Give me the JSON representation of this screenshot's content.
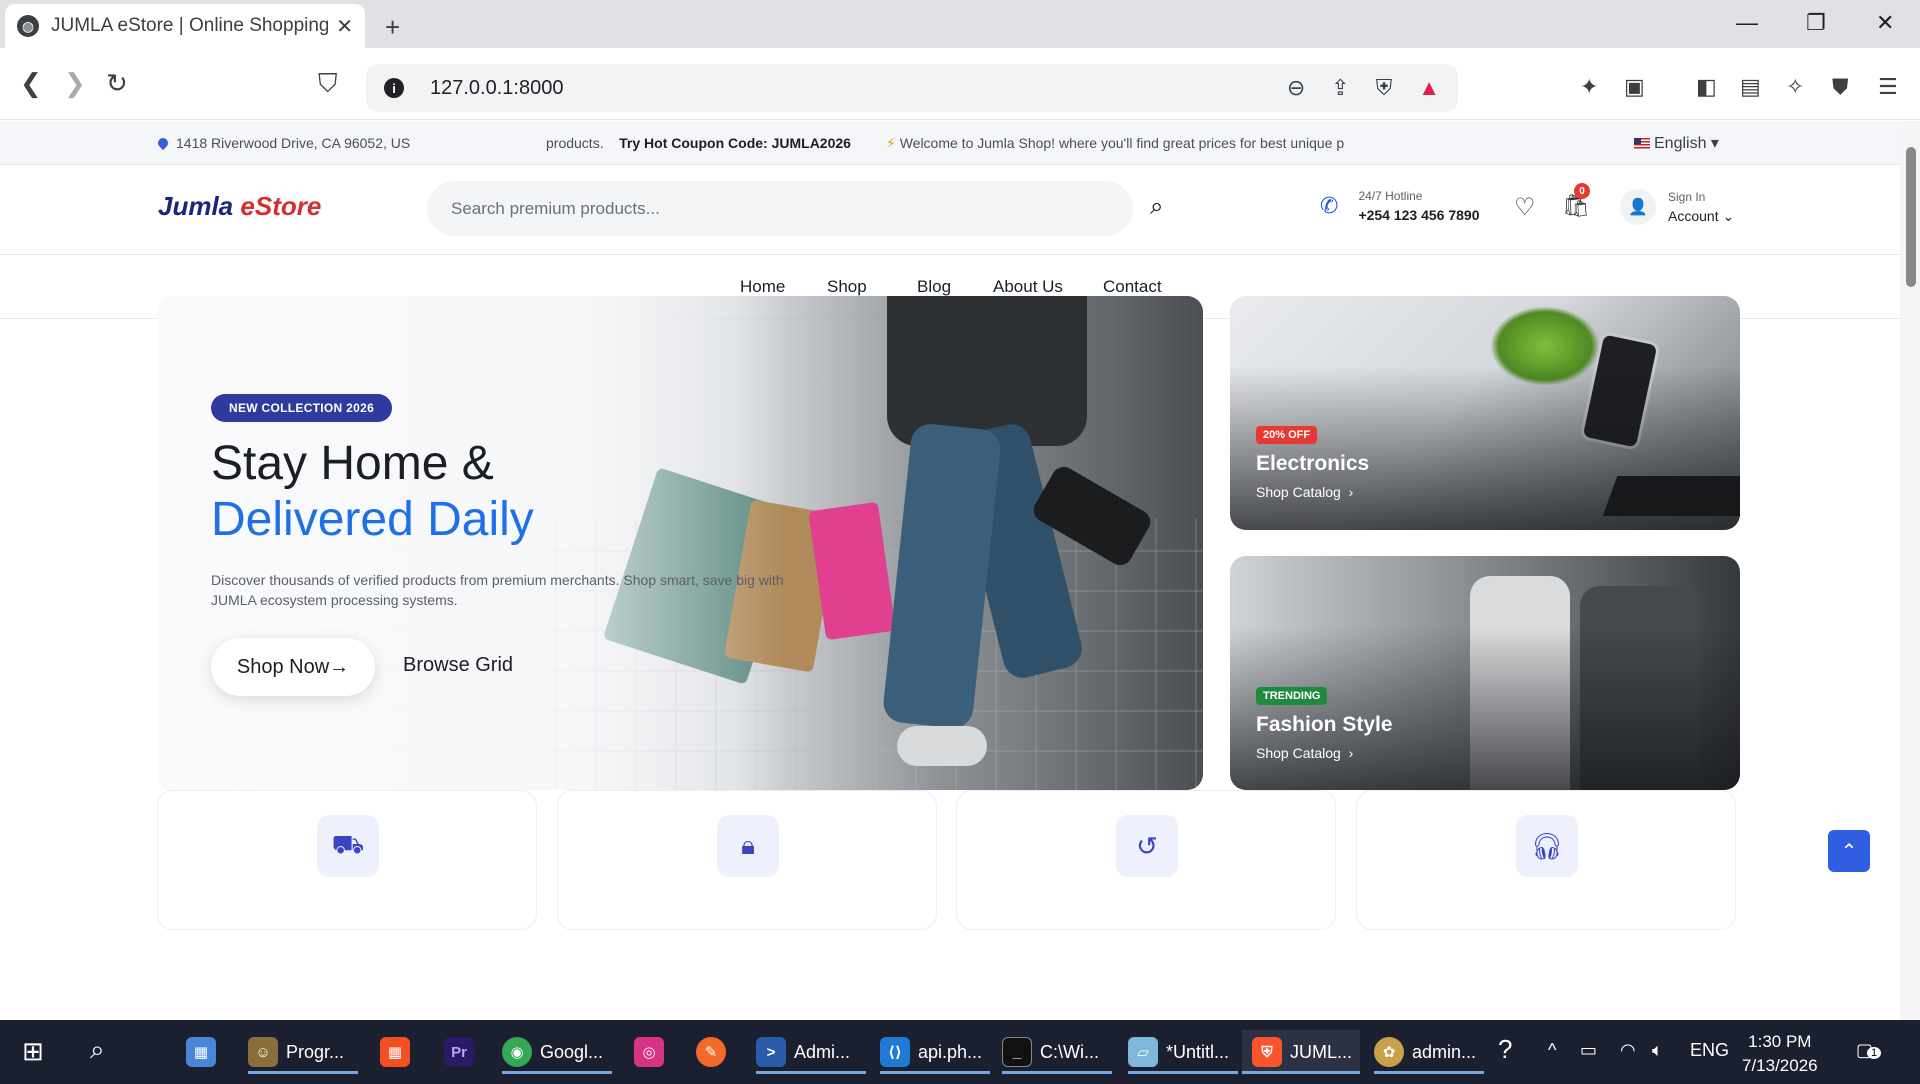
{
  "browser": {
    "tab_title": "JUMLA eStore | Online Shopping",
    "url": "127.0.0.1:8000"
  },
  "topbar": {
    "address": "1418 Riverwood Drive, CA 96052, US",
    "marquee_pre": "products.",
    "marquee_coupon": "Try Hot Coupon Code: JUMLA2026",
    "marquee_welcome": "Welcome to Jumla Shop! where you'll find great prices for best unique p",
    "language": "English"
  },
  "header": {
    "logo_a": "Jumla",
    "logo_b": "eStore",
    "search_placeholder": "Search premium products...",
    "hotline_label": "24/7 Hotline",
    "hotline_number": "+254 123 456 7890",
    "cart_count": "0",
    "signin_label": "Sign In",
    "account_label": "Account"
  },
  "nav": {
    "items": [
      "Home",
      "Shop",
      "Blog",
      "About Us",
      "Contact"
    ]
  },
  "hero": {
    "badge": "NEW COLLECTION 2026",
    "title_line1": "Stay Home &",
    "title_line2": "Delivered Daily",
    "description": "Discover thousands of verified products from premium merchants. Shop smart, save big with JUMLA ecosystem processing systems.",
    "primary_button": "Shop Now",
    "secondary_button": "Browse Grid"
  },
  "promos": [
    {
      "tag": "20% OFF",
      "tag_color": "#e53935",
      "title": "Electronics",
      "link": "Shop Catalog"
    },
    {
      "tag": "TRENDING",
      "tag_color": "#1f8a3e",
      "title": "Fashion Style",
      "link": "Shop Catalog"
    }
  ],
  "features": [
    {
      "icon": "truck-icon"
    },
    {
      "icon": "lock-icon"
    },
    {
      "icon": "return-icon"
    },
    {
      "icon": "headset-icon"
    }
  ],
  "taskbar": {
    "items": [
      "Progr...",
      "Googl...",
      "Admi...",
      "api.ph...",
      "C:\\Wi...",
      "*Untitl...",
      "JUML...",
      "admin..."
    ],
    "language": "ENG",
    "time": "1:30 PM",
    "date": "7/13/2026",
    "notification_count": "1"
  },
  "colors": {
    "accent_blue": "#1f6fe5",
    "badge_navy": "#2f3a9e",
    "to_top": "#2f5fe0"
  }
}
